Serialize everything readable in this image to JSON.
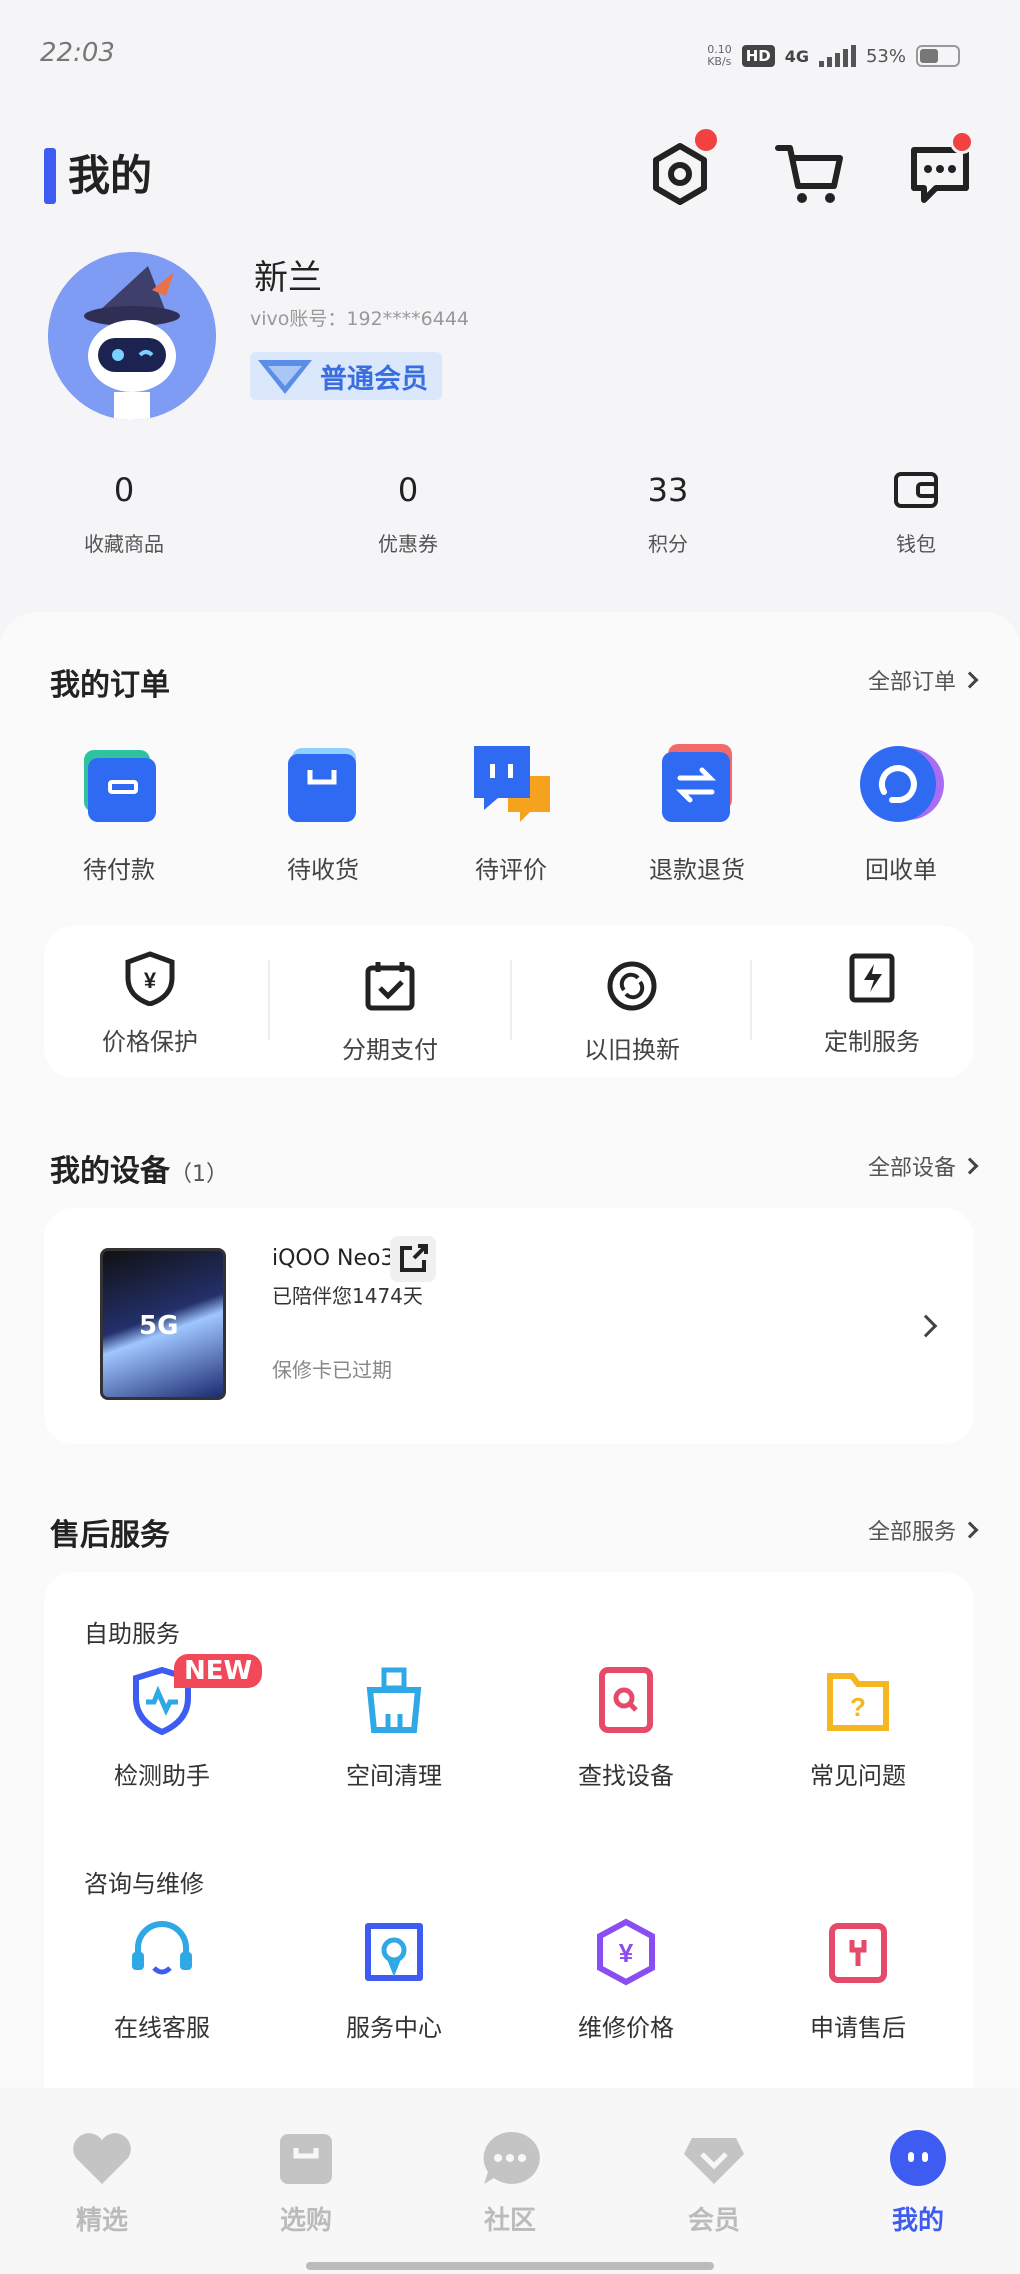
{
  "status": {
    "time": "22:03",
    "speed": "0.10\nKB/s",
    "hd": "HD",
    "net": "4G",
    "battery": "53%"
  },
  "header": {
    "title": "我的"
  },
  "profile": {
    "name": "新兰",
    "account": "vivo账号：192****6444",
    "member": "普通会员"
  },
  "stats": [
    {
      "value": "0",
      "label": "收藏商品"
    },
    {
      "value": "0",
      "label": "优惠券"
    },
    {
      "value": "33",
      "label": "积分"
    },
    {
      "label": "钱包"
    }
  ],
  "orders": {
    "title": "我的订单",
    "more": "全部订单",
    "items": [
      {
        "label": "待付款"
      },
      {
        "label": "待收货"
      },
      {
        "label": "待评价"
      },
      {
        "label": "退款退货"
      },
      {
        "label": "回收单"
      }
    ]
  },
  "services_bar": [
    {
      "label": "价格保护"
    },
    {
      "label": "分期支付"
    },
    {
      "label": "以旧换新"
    },
    {
      "label": "定制服务"
    }
  ],
  "devices": {
    "title": "我的设备",
    "count": "（1）",
    "more": "全部设备",
    "device": {
      "name": "iQOO Neo3",
      "days": "已陪伴您1474天",
      "warranty": "保修卡已过期",
      "badge": "5G"
    }
  },
  "aftersales": {
    "title": "售后服务",
    "more": "全部服务",
    "self_title": "自助服务",
    "self_items": [
      {
        "label": "检测助手",
        "badge": "NEW"
      },
      {
        "label": "空间清理"
      },
      {
        "label": "查找设备"
      },
      {
        "label": "常见问题"
      }
    ],
    "consult_title": "咨询与维修",
    "consult_items": [
      {
        "label": "在线客服"
      },
      {
        "label": "服务中心"
      },
      {
        "label": "维修价格"
      },
      {
        "label": "申请售后"
      }
    ]
  },
  "tabs": [
    {
      "label": "精选"
    },
    {
      "label": "选购"
    },
    {
      "label": "社区"
    },
    {
      "label": "会员"
    },
    {
      "label": "我的"
    }
  ],
  "colors": {
    "accent": "#3f5cf2",
    "red_dot": "#f24141"
  }
}
